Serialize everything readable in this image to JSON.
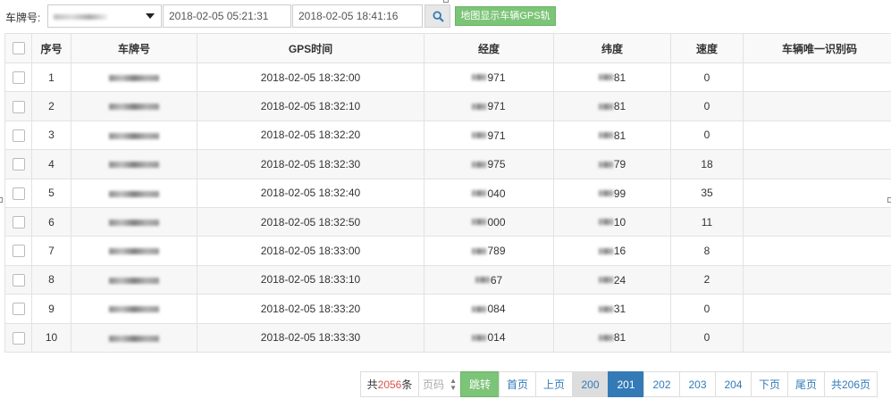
{
  "toolbar": {
    "plate_label": "车牌号:",
    "start_time": "2018-02-05 05:21:31",
    "end_time": "2018-02-05 18:41:16",
    "gps_button": "地图显示车辆GPS轨迹"
  },
  "table": {
    "headers": [
      "序号",
      "车牌号",
      "GPS时间",
      "经度",
      "纬度",
      "速度",
      "车辆唯一识别码"
    ],
    "rows": [
      {
        "no": "1",
        "time": "2018-02-05 18:32:00",
        "lng": "971",
        "lat": "81",
        "speed": "0"
      },
      {
        "no": "2",
        "time": "2018-02-05 18:32:10",
        "lng": "971",
        "lat": "81",
        "speed": "0"
      },
      {
        "no": "3",
        "time": "2018-02-05 18:32:20",
        "lng": "971",
        "lat": "81",
        "speed": "0"
      },
      {
        "no": "4",
        "time": "2018-02-05 18:32:30",
        "lng": "975",
        "lat": "79",
        "speed": "18"
      },
      {
        "no": "5",
        "time": "2018-02-05 18:32:40",
        "lng": "040",
        "lat": "99",
        "speed": "35"
      },
      {
        "no": "6",
        "time": "2018-02-05 18:32:50",
        "lng": "000",
        "lat": "10",
        "speed": "11"
      },
      {
        "no": "7",
        "time": "2018-02-05 18:33:00",
        "lng": "789",
        "lat": "16",
        "speed": "8"
      },
      {
        "no": "8",
        "time": "2018-02-05 18:33:10",
        "lng": "67",
        "lat": "24",
        "speed": "2"
      },
      {
        "no": "9",
        "time": "2018-02-05 18:33:20",
        "lng": "084",
        "lat": "31",
        "speed": "0"
      },
      {
        "no": "10",
        "time": "2018-02-05 18:33:30",
        "lng": "014",
        "lat": "81",
        "speed": "0"
      }
    ]
  },
  "pager": {
    "total_prefix": "共",
    "total_count": "2056",
    "total_suffix": "条",
    "page_input_placeholder": "页码",
    "jump": "跳转",
    "first": "首页",
    "prev": "上页",
    "pages": [
      "200",
      "201",
      "202",
      "203",
      "204"
    ],
    "next": "下页",
    "last": "尾页",
    "total_pages": "共206页"
  },
  "colors": {
    "accent_green": "#7cc477",
    "active_page": "#337ab7",
    "count_red": "#d9534f"
  }
}
